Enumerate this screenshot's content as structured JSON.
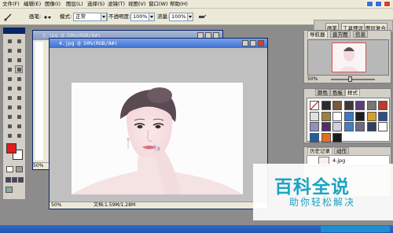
{
  "menu": {
    "items": [
      "文件(F)",
      "编辑(E)",
      "图像(I)",
      "图层(L)",
      "选择(S)",
      "滤镜(T)",
      "视图(V)",
      "窗口(W)",
      "帮助(H)"
    ]
  },
  "options": {
    "brush_label": "画笔:",
    "mode_label": "模式:",
    "mode_value": "正常",
    "opacity_label": "不透明度:",
    "opacity_value": "100%",
    "flow_label": "流量:",
    "flow_value": "100%"
  },
  "top_right": {
    "tabs": [
      "画笔",
      "工具预设",
      "图层复合"
    ]
  },
  "documents": {
    "back1_title": "3.jpg @ 50%(RGB/8#)",
    "back1_zoom": "50%",
    "front_title": "4.jpg @ 50%(RGB/8#)",
    "front_zoom": "50%",
    "front_status": "文档:1.59M/1.28M"
  },
  "navigator": {
    "tabs": [
      "导航器",
      "直方图",
      "信息"
    ],
    "zoom": "50%"
  },
  "styles_panel": {
    "tabs": [
      "颜色",
      "色板",
      "样式"
    ]
  },
  "history_panel": {
    "tabs": [
      "历史记录",
      "动作"
    ],
    "item": "4.jpg"
  },
  "watermark": {
    "logo": "百科全说",
    "sub": "助你轻松解决"
  },
  "colors": {
    "foreground": "#e21e1e",
    "background": "#ffffff",
    "titlebar_active": "#3b6fd6",
    "workspace": "#8c8c8c",
    "watermark": "#1aa4c4"
  },
  "icons": [
    "brush-icon",
    "move-icon",
    "marquee-icon",
    "lasso-icon",
    "magic-wand-icon",
    "crop-icon",
    "slice-icon",
    "healing-icon",
    "stamp-icon",
    "history-brush-icon",
    "eraser-icon",
    "gradient-icon",
    "blur-icon",
    "dodge-icon",
    "path-select-icon",
    "type-icon",
    "pen-icon",
    "shape-icon",
    "notes-icon",
    "eyedropper-icon",
    "hand-icon",
    "zoom-icon"
  ]
}
